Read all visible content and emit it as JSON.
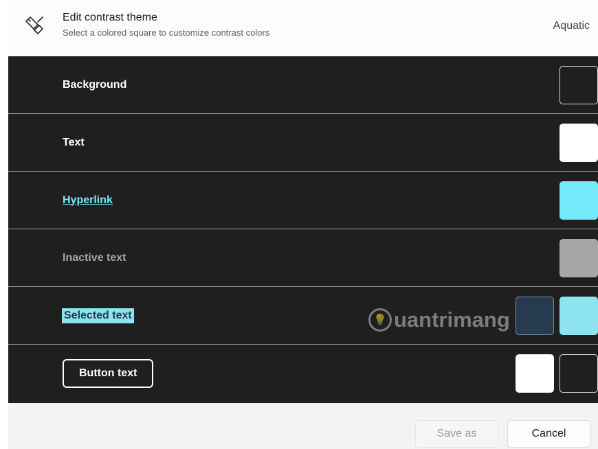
{
  "header": {
    "title": "Edit contrast theme",
    "subtitle": "Select a colored square to customize contrast colors",
    "theme_name": "Aquatic",
    "icon": "paint-brush-icon"
  },
  "rows": [
    {
      "label": "Background",
      "swatches": [
        "#1f1f1f"
      ]
    },
    {
      "label": "Text",
      "swatches": [
        "#ffffff"
      ]
    },
    {
      "label": "Hyperlink",
      "swatches": [
        "#75e9fc"
      ]
    },
    {
      "label": "Inactive text",
      "swatches": [
        "#a6a6a6"
      ]
    },
    {
      "label": "Selected text",
      "swatches": [
        "#263b50",
        "#8ee3f0"
      ]
    },
    {
      "label": "Button text",
      "swatches": [
        "#ffffff",
        "#1f1f1f"
      ]
    }
  ],
  "watermark": {
    "text": "uantrimang"
  },
  "footer": {
    "save_as_label": "Save as",
    "cancel_label": "Cancel"
  },
  "colors": {
    "canvas": "#1f1f1f",
    "hyperlink": "#75e9fc",
    "selected_bg": "#8ee3f0",
    "selected_fg": "#263b50",
    "inactive": "#a6a6a6"
  }
}
